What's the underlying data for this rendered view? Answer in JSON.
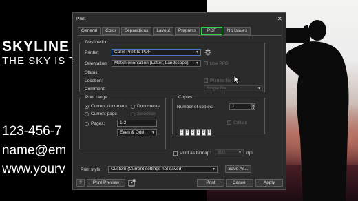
{
  "background": {
    "brand": "SKYLINE",
    "tagline": "THE SKY IS T",
    "phone": "123-456-7",
    "email": "name@em",
    "website": "www.yourv"
  },
  "dialog": {
    "title": "Print",
    "close_glyph": "✕",
    "tabs": [
      {
        "label": "General",
        "active": true
      },
      {
        "label": "Color"
      },
      {
        "label": "Separations"
      },
      {
        "label": "Layout"
      },
      {
        "label": "Prepress"
      },
      {
        "label": "PDF",
        "highlighted": true,
        "outline_color": "#2fd04a"
      },
      {
        "label": "No Issues"
      }
    ],
    "destination": {
      "legend": "Destination",
      "printer_label": "Printer:",
      "printer_value": "Corel Print to PDF",
      "orientation_label": "Orientation:",
      "orientation_value": "Match orientation (Letter, Landscape)",
      "use_ppd_label": "Use PPD",
      "status_label": "Status:",
      "location_label": "Location:",
      "comment_label": "Comment:",
      "print_to_file_label": "Print to file",
      "single_file_value": "Single file",
      "settings_icon": "gear-icon"
    },
    "print_range": {
      "legend": "Print range",
      "current_document": "Current document",
      "documents": "Documents",
      "current_page": "Current page",
      "selection": "Selection",
      "pages_label": "Pages:",
      "pages_value": "1-2",
      "page_set_value": "Even & Odd"
    },
    "copies": {
      "legend": "Copies",
      "number_label": "Number of copies:",
      "number_value": "1",
      "collate_label": "Collate",
      "collate_pages": [
        "1",
        "2",
        "3",
        "1",
        "2",
        "3"
      ]
    },
    "print_as_bitmap": {
      "label": "Print as bitmap:",
      "value": "300",
      "unit": "dpi"
    },
    "print_style": {
      "label": "Print style:",
      "value": "Custom (Current settings not saved)",
      "save_as": "Save As..."
    },
    "footer": {
      "help": "?",
      "print_preview": "Print Preview",
      "popout_icon": "external-link-icon",
      "print": "Print",
      "cancel": "Cancel",
      "apply": "Apply"
    }
  },
  "colors": {
    "accent_pdf_outline": "#2fd04a",
    "dialog_bg": "#2b2b2b"
  }
}
